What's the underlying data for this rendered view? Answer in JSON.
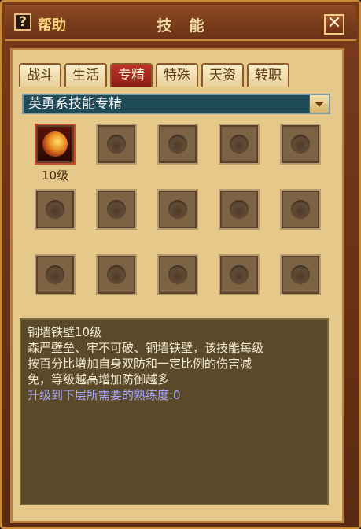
{
  "window": {
    "help_icon": "?",
    "help_label": "帮助",
    "title": "技能",
    "close_icon": "✕"
  },
  "tabs": [
    {
      "label": "战斗",
      "active": false
    },
    {
      "label": "生活",
      "active": false
    },
    {
      "label": "专精",
      "active": true
    },
    {
      "label": "特殊",
      "active": false
    },
    {
      "label": "天资",
      "active": false
    },
    {
      "label": "转职",
      "active": false
    }
  ],
  "category_select": {
    "value": "英勇系技能专精"
  },
  "skills": {
    "slot_1_level": "10级"
  },
  "description": {
    "name_line": "铜墙铁壁10级",
    "text_1": "森严壁垒、牢不可破、铜墙铁壁，该技能每级",
    "text_2": "按百分比增加自身双防和一定比例的伤害减",
    "text_3": "免，等级越高增加防御越多",
    "progress": "升级到下层所需要的熟练度:0"
  },
  "colors": {
    "active_tab": "#c0342a",
    "progress_text": "#a7a6ff",
    "panel_bg": "#e6c98a"
  }
}
